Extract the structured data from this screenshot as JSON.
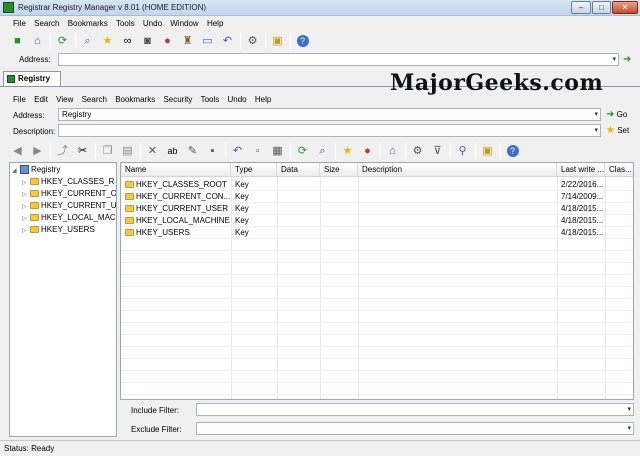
{
  "window": {
    "title": "Registrar Registry Manager v 8.01 (HOME EDITION)",
    "minimize": "–",
    "maximize": "□",
    "close": "✕"
  },
  "main_menu": [
    "File",
    "Search",
    "Bookmarks",
    "Tools",
    "Undo",
    "Window",
    "Help"
  ],
  "main_address": {
    "label": "Address:",
    "value": ""
  },
  "doc_tab": {
    "label": "Registry"
  },
  "brand": "MajorGeeks.com",
  "child_menu": [
    "File",
    "Edit",
    "View",
    "Search",
    "Bookmarks",
    "Security",
    "Tools",
    "Undo",
    "Help"
  ],
  "child_address": {
    "label": "Address:",
    "value": "Registry",
    "go": "Go"
  },
  "description": {
    "label": "Description:",
    "value": "",
    "set": "Set"
  },
  "tree": {
    "root": "Registry",
    "nodes": [
      "HKEY_CLASSES_R",
      "HKEY_CURRENT_C",
      "HKEY_CURRENT_U",
      "HKEY_LOCAL_MAC",
      "HKEY_USERS"
    ]
  },
  "list": {
    "columns": [
      "Name",
      "Type",
      "Data",
      "Size",
      "Description",
      "Last write ...",
      "Clas..."
    ],
    "rows": [
      {
        "name": "HKEY_CLASSES_ROOT",
        "type": "Key",
        "date": "2/22/2016..."
      },
      {
        "name": "HKEY_CURRENT_CON...",
        "type": "Key",
        "date": "7/14/2009..."
      },
      {
        "name": "HKEY_CURRENT_USER",
        "type": "Key",
        "date": "4/18/2015..."
      },
      {
        "name": "HKEY_LOCAL_MACHINE",
        "type": "Key",
        "date": "4/18/2015..."
      },
      {
        "name": "HKEY_USERS",
        "type": "Key",
        "date": "4/18/2015..."
      }
    ]
  },
  "filters": {
    "include_label": "Include Filter:",
    "exclude_label": "Exclude Filter:",
    "include_value": "",
    "exclude_value": ""
  },
  "status": "Status: Ready"
}
